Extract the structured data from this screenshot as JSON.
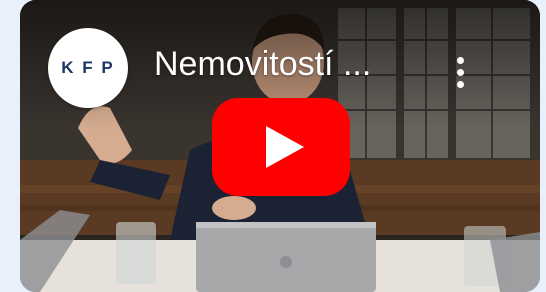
{
  "channel": {
    "logo_text": "KFP",
    "avatar_icon": "kfp-logo-icon"
  },
  "video": {
    "title": "Nemovitostí ...",
    "play_icon": "youtube-play-icon",
    "more_icon": "more-vert-icon"
  },
  "colors": {
    "play_red": "#ff0000",
    "logo_navy": "#1f3364",
    "page_bg": "#e8f1fb"
  }
}
